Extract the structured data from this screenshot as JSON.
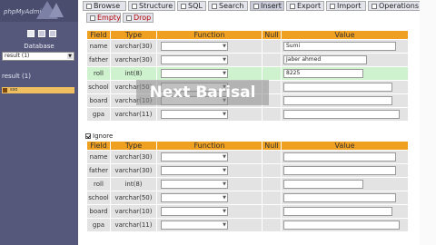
{
  "nav": {
    "logo_text": "phpMyAdmin",
    "db_label": "Database",
    "db_select": "result (1)",
    "db_title": "result (1)",
    "table_item": "sso"
  },
  "tabs": [
    {
      "label": "Browse"
    },
    {
      "label": "Structure"
    },
    {
      "label": "SQL"
    },
    {
      "label": "Search"
    },
    {
      "label": "Insert"
    },
    {
      "label": "Export"
    },
    {
      "label": "Import"
    },
    {
      "label": "Operations"
    },
    {
      "label": "Empty"
    },
    {
      "label": "Drop"
    }
  ],
  "active_tab": "Insert",
  "headers": {
    "field": "Field",
    "type": "Type",
    "function": "Function",
    "null": "Null",
    "value": "Value"
  },
  "form1": {
    "rows": [
      {
        "field": "name",
        "type": "varchar(30)",
        "value": "Sumi"
      },
      {
        "field": "father",
        "type": "varchar(30)",
        "value": "Jaber ahmed"
      },
      {
        "field": "roll",
        "type": "int(8)",
        "value": "8225"
      },
      {
        "field": "school",
        "type": "varchar(50)",
        "value": ""
      },
      {
        "field": "board",
        "type": "varchar(10)",
        "value": ""
      },
      {
        "field": "gpa",
        "type": "varchar(11)",
        "value": ""
      }
    ]
  },
  "ignore_label": "Ignore",
  "form2": {
    "rows": [
      {
        "field": "name",
        "type": "varchar(30)",
        "value": ""
      },
      {
        "field": "father",
        "type": "varchar(30)",
        "value": ""
      },
      {
        "field": "roll",
        "type": "int(8)",
        "value": ""
      },
      {
        "field": "school",
        "type": "varchar(50)",
        "value": ""
      },
      {
        "field": "board",
        "type": "varchar(10)",
        "value": ""
      },
      {
        "field": "gpa",
        "type": "varchar(11)",
        "value": ""
      }
    ]
  },
  "watermark": "Next Barisal",
  "colors": {
    "header": "#f0a020",
    "active_row": "#cdf2cd",
    "nav": "#55587a"
  }
}
